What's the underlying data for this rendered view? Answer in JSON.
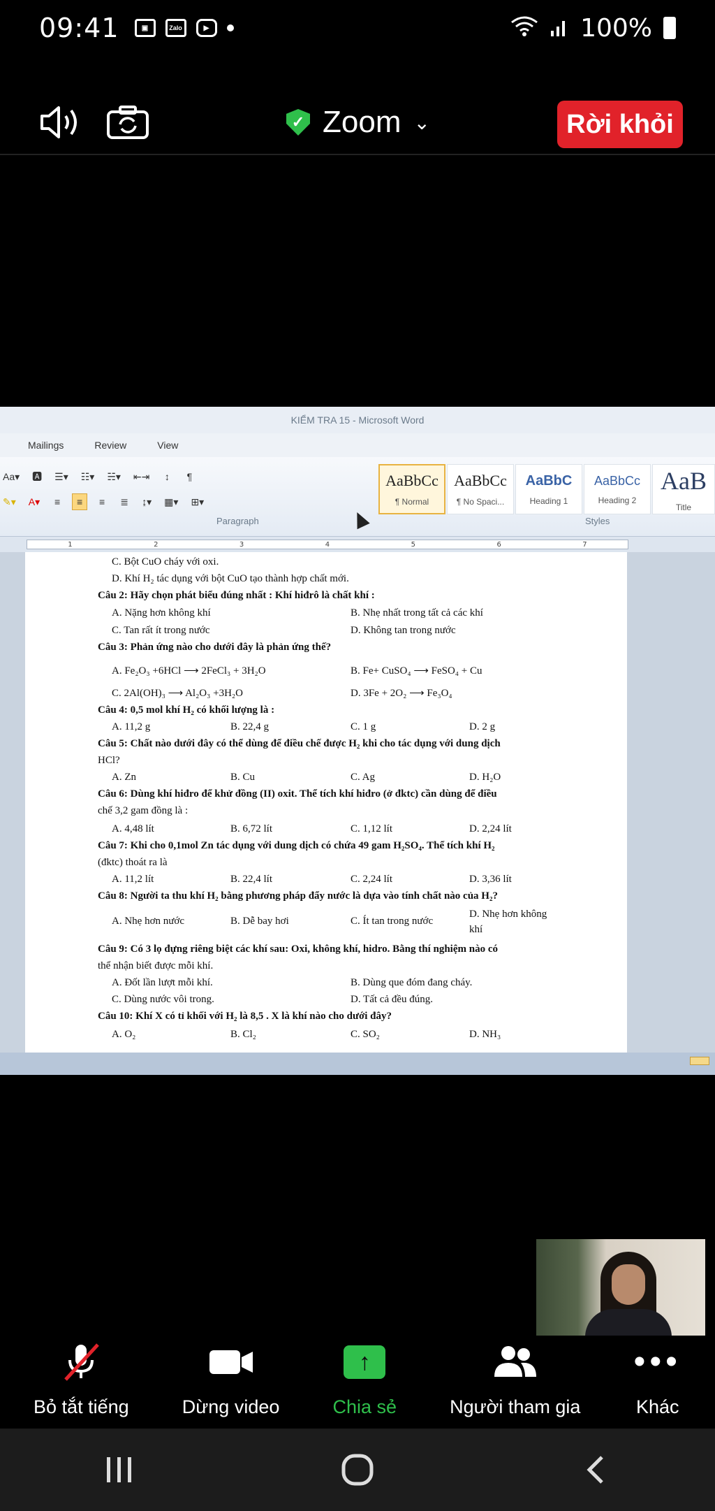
{
  "status_bar": {
    "time": "09:41",
    "battery": "100%",
    "icons": [
      "gallery-icon",
      "zalo-icon",
      "youtube-icon",
      "wifi-icon",
      "signal-icon",
      "battery-icon"
    ],
    "zalo_label": "Zalo"
  },
  "zoom_header": {
    "title": "Zoom",
    "leave_label": "Rời khỏi",
    "colors": {
      "leave": "#e1222a",
      "shield": "#2fbf4b"
    }
  },
  "word": {
    "title": "KIỂM TRA 15  -  Microsoft Word",
    "tabs": [
      "Mailings",
      "Review",
      "View"
    ],
    "groups": {
      "paragraph": "Paragraph",
      "styles": "Styles"
    },
    "styles": [
      {
        "sample": "AaBbCc",
        "name": "¶ Normal"
      },
      {
        "sample": "AaBbCc",
        "name": "¶ No Spaci..."
      },
      {
        "sample": "AaBbC",
        "name": "Heading 1"
      },
      {
        "sample": "AaBbCc",
        "name": "Heading 2"
      },
      {
        "sample": "AaB",
        "name": "Title"
      }
    ],
    "ruler": [
      "1",
      "2",
      "3",
      "4",
      "5",
      "6",
      "7"
    ],
    "doc_lines": [
      "C. Bột CuO cháy với oxi.",
      "D. Khí H₂ tác dụng với bột CuO tạo thành hợp chất mới.",
      "Câu 2: Hãy chọn phát biểu đúng nhất : Khí hiđrô là chất khí :",
      "A. Nặng hơn không khí",
      "B. Nhẹ nhất trong tất cả các khí",
      "C. Tan rất ít trong nước",
      "D. Không tan trong nước",
      "Câu 3: Phản ứng nào cho dưới đây là phản ứng thế?",
      "A. Fe₂O₃ +6HCl ⟶ 2FeCl₃ + 3H₂O",
      "B. Fe+ CuSO₄ ⟶ FeSO₄ + Cu",
      "C. 2Al(OH)₃ ⟶ Al₂O₃ +3H₂O",
      "D. 3Fe + 2O₂ ⟶ Fe₃O₄",
      "Câu 4: 0,5 mol khí H₂  có khối lượng là :",
      "A. 11,2 g",
      "B. 22,4 g",
      "C. 1 g",
      "D. 2 g",
      "Câu 5: Chất nào dưới đây có thể dùng để điều chế được H₂ khi cho tác dụng với dung dịch",
      "HCl?",
      "A. Zn",
      "B. Cu",
      "C. Ag",
      "D. H₂O",
      "Câu 6: Dùng khí hiđro để khử đồng (II) oxit. Thể tích khí hiđro (ở đktc) cần dùng để điều",
      "chế 3,2 gam đồng là :",
      "A. 4,48 lít",
      "B. 6,72 lít",
      "C. 1,12 lít",
      "D. 2,24 lít",
      "Câu 7: Khi cho 0,1mol Zn tác dụng với dung dịch có chứa 49 gam H₂SO₄. Thể tích khí H₂",
      "(đktc) thoát ra là",
      "A. 11,2 lít",
      "B. 22,4 lít",
      "C. 2,24 lít",
      "D. 3,36 lít",
      "Câu 8: Người ta thu khí H₂ bằng phương pháp đẩy nước là dựa vào tính chất nào của H₂?",
      "A. Nhẹ hơn nước",
      "B. Dễ bay hơi",
      "C. Ít tan trong nước",
      "D. Nhẹ hơn không",
      "khí",
      "Câu 9: Có 3 lọ đựng riêng biệt các khí sau: Oxi, không khí, hidro. Bằng thí nghiệm nào có",
      "thể nhận biết được mỗi khí.",
      "A. Đốt lần lượt mỗi khí.",
      "B. Dùng que đóm đang cháy.",
      "C. Dùng nước vôi trong.",
      "D. Tất cả đều đúng.",
      "Câu 10: Khí X có tỉ khối với H₂ là 8,5 . X là khí nào cho dưới đây?",
      "A. O₂",
      "B. Cl₂",
      "C. SO₂",
      "D. NH₃"
    ]
  },
  "toolbar": {
    "items": [
      {
        "label": "Bỏ tắt tiếng",
        "icon": "muted-mic-icon"
      },
      {
        "label": "Dừng video",
        "icon": "video-camera-icon"
      },
      {
        "label": "Chia sẻ",
        "icon": "share-arrow-icon"
      },
      {
        "label": "Người tham gia",
        "icon": "participants-icon"
      },
      {
        "label": "Khác",
        "icon": "more-icon"
      }
    ],
    "share_color": "#2fbf4b"
  },
  "nav": {
    "icons": [
      "recents-icon",
      "home-icon",
      "back-icon"
    ]
  }
}
